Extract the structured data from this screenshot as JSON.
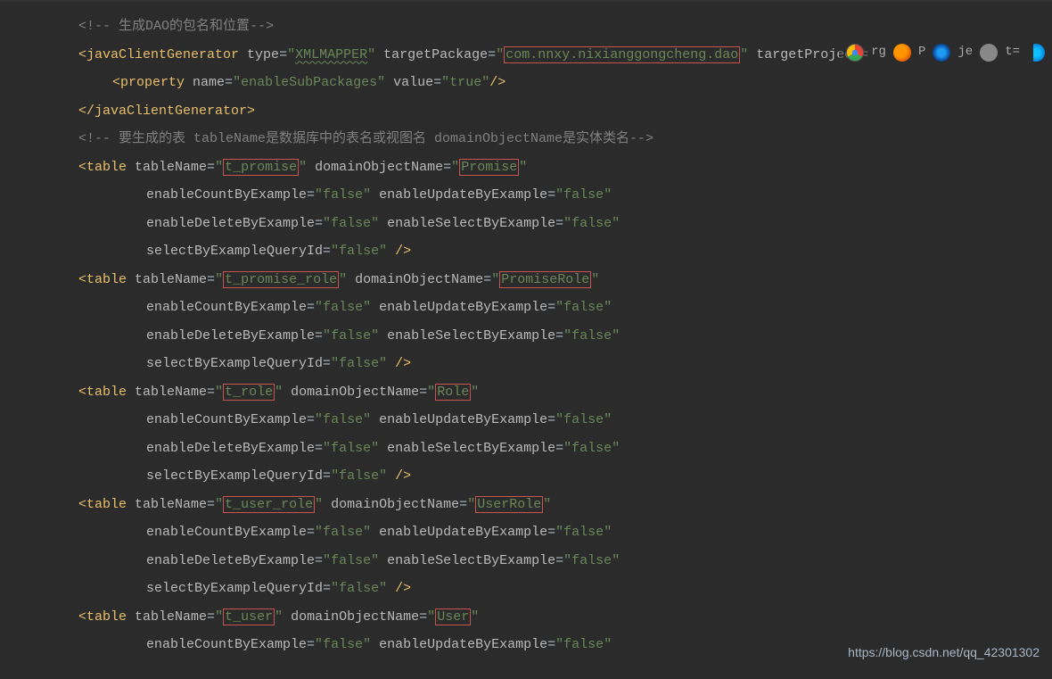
{
  "comment1": "<!-- 生成DAO的包名和位置-->",
  "javaClientGenerator": {
    "type": "XMLMAPPER",
    "targetPackage": "com.nnxy.nixianggongcheng.dao",
    "targetProjectFragment": "targetProject=",
    "property": {
      "name": "enableSubPackages",
      "value": "true"
    }
  },
  "comment2": "<!-- 要生成的表 tableName是数据库中的表名或视图名 domainObjectName是实体类名-->",
  "tables": [
    {
      "tableName": "t_promise",
      "domainObjectName": "Promise"
    },
    {
      "tableName": "t_promise_role",
      "domainObjectName": "PromiseRole"
    },
    {
      "tableName": "t_role",
      "domainObjectName": "Role"
    },
    {
      "tableName": "t_user_role",
      "domainObjectName": "UserRole"
    },
    {
      "tableName": "t_user",
      "domainObjectName": "User"
    }
  ],
  "tableAttrs": {
    "enableCountByExample": "false",
    "enableUpdateByExample": "false",
    "enableDeleteByExample": "false",
    "enableSelectByExample": "false",
    "selectByExampleQueryId": "false"
  },
  "watermark": "https://blog.csdn.net/qq_42301302"
}
